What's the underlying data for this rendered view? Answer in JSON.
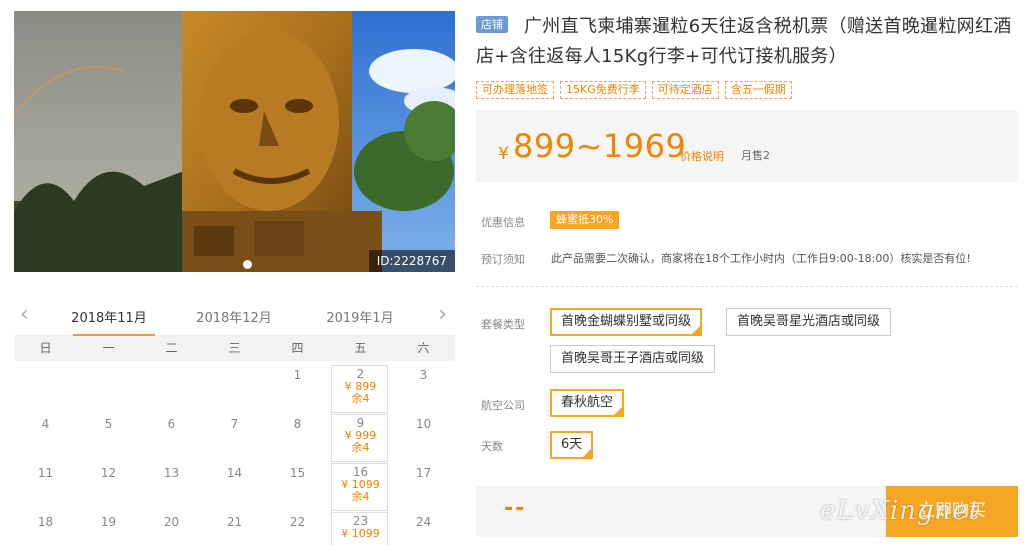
{
  "gallery": {
    "image_id": "ID:2228767",
    "dots": 1
  },
  "calendar": {
    "months": [
      "2018年11月",
      "2018年12月",
      "2019年1月"
    ],
    "weekdays": [
      "日",
      "一",
      "二",
      "三",
      "四",
      "五",
      "六"
    ],
    "rows": [
      [
        {
          "d": ""
        },
        {
          "d": ""
        },
        {
          "d": ""
        },
        {
          "d": ""
        },
        {
          "d": "1"
        },
        {
          "d": "2",
          "price": "¥ 899",
          "stock": "余4"
        },
        {
          "d": "3"
        }
      ],
      [
        {
          "d": "4"
        },
        {
          "d": "5"
        },
        {
          "d": "6"
        },
        {
          "d": "7"
        },
        {
          "d": "8"
        },
        {
          "d": "9",
          "price": "¥ 999",
          "stock": "余4"
        },
        {
          "d": "10"
        }
      ],
      [
        {
          "d": "11"
        },
        {
          "d": "12"
        },
        {
          "d": "13"
        },
        {
          "d": "14"
        },
        {
          "d": "15"
        },
        {
          "d": "16",
          "price": "¥ 1099",
          "stock": "余4"
        },
        {
          "d": "17"
        }
      ],
      [
        {
          "d": "18"
        },
        {
          "d": "19"
        },
        {
          "d": "20"
        },
        {
          "d": "21"
        },
        {
          "d": "22"
        },
        {
          "d": "23",
          "price": "¥ 1099",
          "stock": ""
        },
        {
          "d": "24"
        }
      ]
    ]
  },
  "product": {
    "shop_badge": "店铺",
    "title": "广州直飞柬埔寨暹粒6天往返含税机票（赠送首晚暹粒网红酒店+含往返每人15Kg行李+可代订接机服务）",
    "tags": [
      "可办理落地签",
      "15KG免费行李",
      "可待定酒店",
      "含五一假期"
    ],
    "price_symbol": "¥",
    "price_range": "899~1969",
    "price_note": "价格说明",
    "monthly_sales": "月售2"
  },
  "info": {
    "promo_label": "优惠信息",
    "promo_badge": "蜂蜜抵30%",
    "notice_label": "预订须知",
    "notice_text": "此产品需要二次确认，商家将在18个工作小时内（工作日9:00-18:00）核实是否有位!"
  },
  "options": {
    "package_label": "套餐类型",
    "packages": [
      "首晚金蝴蝶别墅或同级",
      "首晚吴哥星光酒店或同级",
      "首晚吴哥王子酒店或同级"
    ],
    "airline_label": "航空公司",
    "airline": "春秋航空",
    "days_label": "天数",
    "days": "6天"
  },
  "buy": {
    "total": "--",
    "button": "立即购买"
  },
  "watermark": "eLvXingnet",
  "colors": {
    "accent": "#f6a623",
    "price": "#f08300",
    "badge_blue": "#6c9bd8"
  }
}
